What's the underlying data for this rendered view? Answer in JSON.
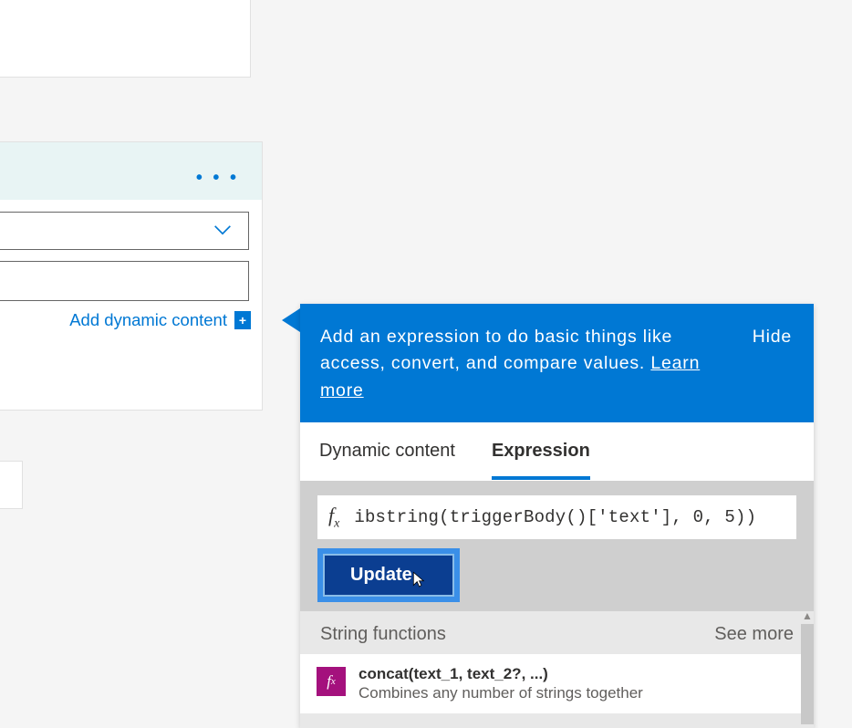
{
  "left_card": {
    "add_dynamic_content": "Add dynamic content",
    "plus": "+"
  },
  "flyout": {
    "header_text_1": "Add an expression to do basic things like access, convert, and compare values. ",
    "header_learn": "Learn more",
    "hide": "Hide",
    "tabs": {
      "dynamic": "Dynamic content",
      "expression": "Expression"
    },
    "fx_label": "fx",
    "expression_value": "ibstring(triggerBody()['text'], 0, 5))",
    "update_label": "Update",
    "section_title": "String functions",
    "see_more": "See more",
    "func1": {
      "icon": "fx",
      "title": "concat(text_1, text_2?, ...)",
      "desc": "Combines any number of strings together"
    }
  }
}
